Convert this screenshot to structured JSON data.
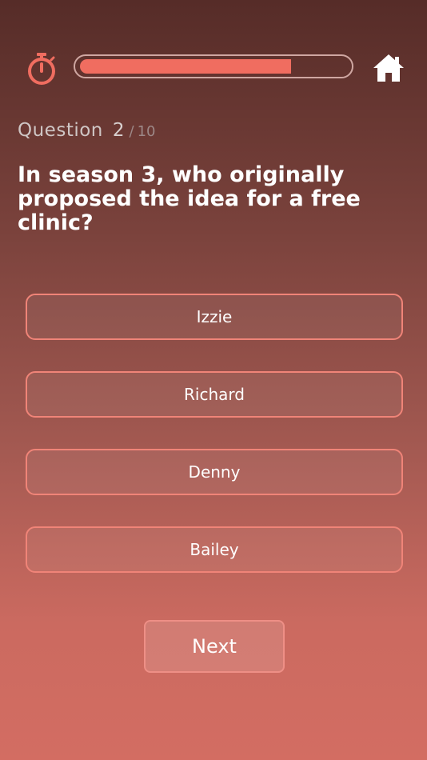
{
  "header": {
    "timer_icon": "stopwatch-icon",
    "home_icon": "home-icon",
    "progress": 0.79,
    "accent_color": "#f06d60"
  },
  "question": {
    "label": "Question",
    "current": "2",
    "slash": "/",
    "total": "10",
    "text": "In season 3, who originally proposed the idea for a free clinic?"
  },
  "answers": [
    {
      "label": "Izzie"
    },
    {
      "label": "Richard"
    },
    {
      "label": "Denny"
    },
    {
      "label": "Bailey"
    }
  ],
  "next_label": "Next"
}
